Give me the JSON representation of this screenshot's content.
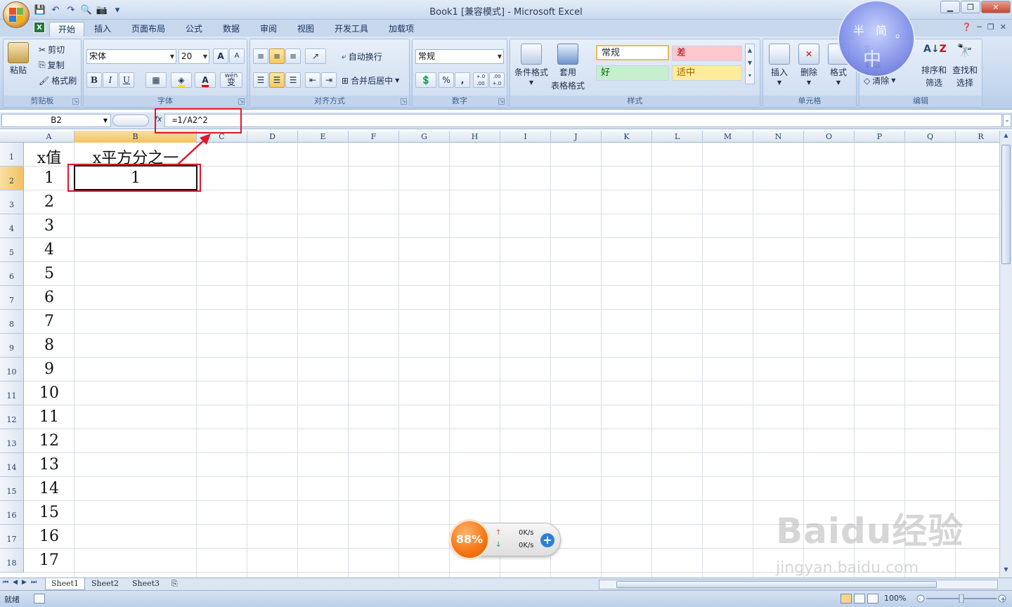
{
  "window": {
    "title": "Book1  [兼容模式] - Microsoft Excel"
  },
  "ribbon_tabs": [
    "开始",
    "插入",
    "页面布局",
    "公式",
    "数据",
    "审阅",
    "视图",
    "开发工具",
    "加载项"
  ],
  "clipboard": {
    "paste": "粘贴",
    "cut": "剪切",
    "copy": "复制",
    "format_painter": "格式刷",
    "group": "剪贴板"
  },
  "font": {
    "name": "宋体",
    "size": "20",
    "bold": "B",
    "italic": "I",
    "underline": "U",
    "group": "字体",
    "grow": "A",
    "shrink": "A",
    "wen": "wén",
    "wen_char": "变"
  },
  "alignment": {
    "wrap": "自动换行",
    "merge": "合并后居中",
    "group": "对齐方式"
  },
  "number": {
    "format": "常规",
    "percent": "%",
    "comma": ",",
    "inc": "+.0 .00",
    "dec": ".00 +.0",
    "group": "数字"
  },
  "styles": {
    "cond_format": "条件格式",
    "table_format_1": "套用",
    "table_format_2": "表格格式",
    "normal": "常规",
    "bad": "差",
    "good": "好",
    "neutral": "适中",
    "group": "样式"
  },
  "cells": {
    "insert": "插入",
    "delete": "删除",
    "format": "格式",
    "group": "单元格"
  },
  "editing": {
    "sum": "Σ",
    "fill": "填",
    "clear": "清除",
    "sort_1": "排序和",
    "sort_2": "筛选",
    "find_1": "查找和",
    "find_2": "选择",
    "group": "编辑"
  },
  "avatar": {
    "t1": "半",
    "t2": "简",
    "t3": "。",
    "t4": "中"
  },
  "formula_bar": {
    "name_box": "B2",
    "fx": "fx",
    "formula": "=1/A2^2"
  },
  "columns": [
    "A",
    "B",
    "C",
    "D",
    "E",
    "F",
    "G",
    "H",
    "I",
    "J",
    "K",
    "L",
    "M",
    "N",
    "O",
    "P",
    "Q",
    "R"
  ],
  "rows": [
    "1",
    "2",
    "3",
    "4",
    "5",
    "6",
    "7",
    "8",
    "9",
    "10",
    "11",
    "12",
    "13",
    "14",
    "15",
    "16",
    "17",
    "18"
  ],
  "cells_data": {
    "A1": "x值",
    "B1": "x平方分之一",
    "A2": "1",
    "B2": "1",
    "A3": "2",
    "A4": "3",
    "A5": "4",
    "A6": "5",
    "A7": "6",
    "A8": "7",
    "A9": "8",
    "A10": "9",
    "A11": "10",
    "A12": "11",
    "A13": "12",
    "A14": "13",
    "A15": "14",
    "A16": "15",
    "A17": "16",
    "A18": "17"
  },
  "sheets": [
    "Sheet1",
    "Sheet2",
    "Sheet3"
  ],
  "status": {
    "ready": "就绪",
    "zoom": "100%"
  },
  "net_widget": {
    "percent": "88%",
    "up": "0K/s",
    "down": "0K/s"
  },
  "watermark": {
    "brand": "Baidu经验",
    "url": "jingyan.baidu.com"
  },
  "colors": {
    "accent": "#e0182a",
    "selection_header": "#f2c15f",
    "ribbon": "#c5d7ee"
  }
}
